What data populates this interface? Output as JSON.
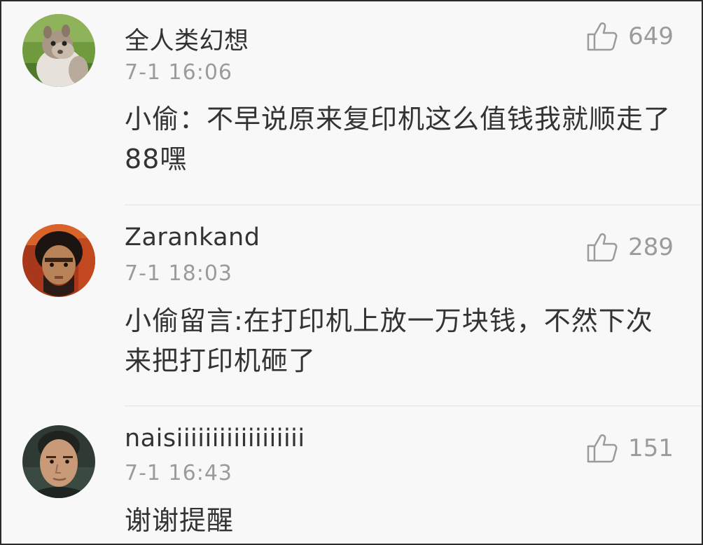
{
  "comments": [
    {
      "username": "全人类幻想",
      "timestamp": "7-1 16:06",
      "text": "小偷：不早说原来复印机这么值钱我就顺走了88嘿",
      "likes": "649",
      "avatar": "squirrel-avatar"
    },
    {
      "username": "Zarankand",
      "timestamp": "7-1 18:03",
      "text": "小偷留言:在打印机上放一万块钱，不然下次来把打印机砸了",
      "likes": "289",
      "avatar": "bearded-man-avatar"
    },
    {
      "username": "naisiiiiiiiiiiiiiiiiii",
      "timestamp": "7-1 16:43",
      "text": "谢谢提醒",
      "likes": "151",
      "avatar": "man-portrait-avatar"
    }
  ],
  "colors": {
    "background": "#f8f8f8",
    "text": "#333333",
    "muted": "#9b9b9b",
    "divider": "#e2e2e2"
  }
}
